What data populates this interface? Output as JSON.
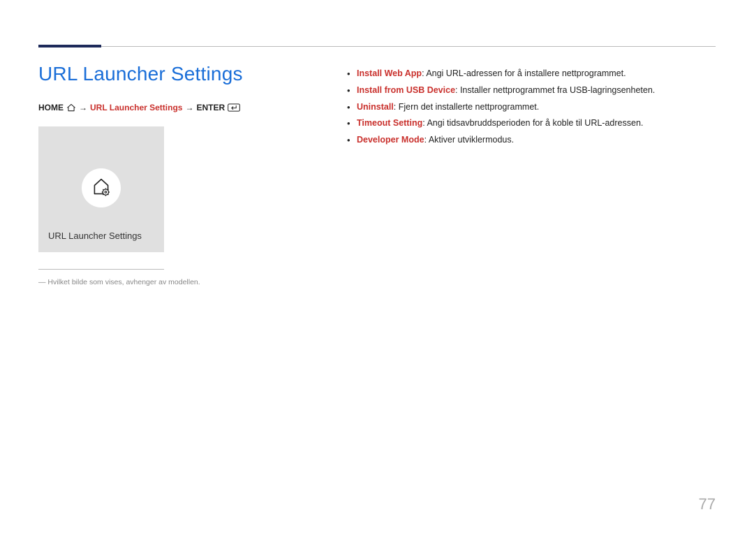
{
  "title": "URL Launcher Settings",
  "breadcrumb": {
    "home": "HOME",
    "middle": "URL Launcher Settings",
    "enter": "ENTER",
    "arrow": "→"
  },
  "tile": {
    "label": "URL Launcher Settings"
  },
  "note": "― Hvilket bilde som vises, avhenger av modellen.",
  "bullets": [
    {
      "label": "Install Web App",
      "desc": ": Angi URL-adressen for å installere nettprogrammet."
    },
    {
      "label": "Install from USB Device",
      "desc": ": Installer nettprogrammet fra USB-lagringsenheten."
    },
    {
      "label": "Uninstall",
      "desc": ": Fjern det installerte nettprogrammet."
    },
    {
      "label": "Timeout Setting",
      "desc": ": Angi tidsavbruddsperioden for å koble til URL-adressen."
    },
    {
      "label": "Developer Mode",
      "desc": ": Aktiver utviklermodus."
    }
  ],
  "page_number": "77"
}
